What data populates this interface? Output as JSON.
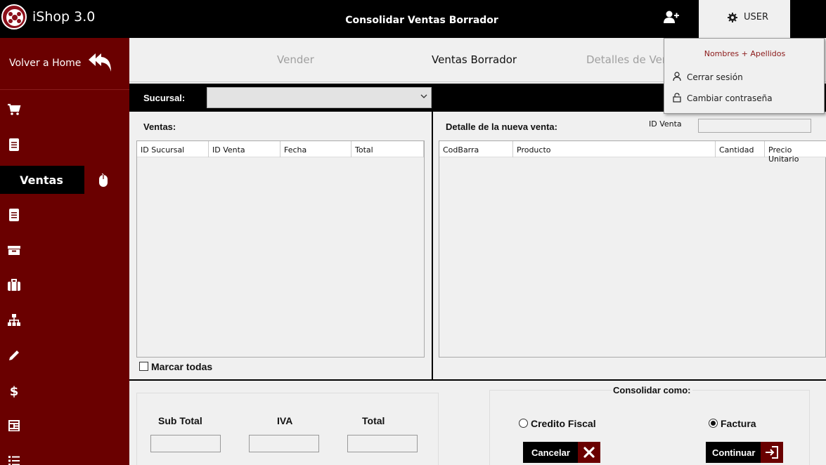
{
  "app": {
    "name": "iShop 3.0",
    "page_title": "Consolidar Ventas Borrador"
  },
  "header": {
    "user_label": "USER"
  },
  "user_menu": {
    "name": "Nombres + Apellidos",
    "items": [
      {
        "label": "Cerrar sesión",
        "icon": "person-icon"
      },
      {
        "label": "Cambiar contraseña",
        "icon": "lock-icon"
      }
    ]
  },
  "sidebar": {
    "home_label": "Volver a Home",
    "active_label": "Ventas",
    "icons": [
      "cart-icon",
      "document-icon",
      "document-icon",
      "inbox-icon",
      "briefcase-icon",
      "sitemap-icon",
      "pencil-icon",
      "dollar-icon",
      "newspaper-icon",
      "list-icon"
    ]
  },
  "tabs": [
    {
      "label": "Vender",
      "active": false
    },
    {
      "label": "Ventas Borrador",
      "active": true
    },
    {
      "label": "Detalles de Venta",
      "active": false
    }
  ],
  "filters": {
    "sucursal_label": "Sucursal:",
    "sucursal_value": ""
  },
  "ventas": {
    "title": "Ventas:",
    "columns": [
      "ID Sucursal",
      "ID Venta",
      "Fecha",
      "Total"
    ],
    "rows": [],
    "select_all_label": "Marcar todas"
  },
  "detalle": {
    "title": "Detalle de la nueva venta:",
    "id_venta_label": "ID Venta",
    "id_venta_value": "",
    "columns": [
      "CodBarra",
      "Producto",
      "Cantidad",
      "Precio Unitario"
    ],
    "rows": []
  },
  "totals": {
    "subtotal_label": "Sub Total",
    "iva_label": "IVA",
    "total_label": "Total"
  },
  "consolidar": {
    "title": "Consolidar como:",
    "options": [
      "Credito Fiscal",
      "Factura"
    ],
    "selected": "Factura",
    "cancel_label": "Cancelar",
    "continue_label": "Continuar"
  },
  "colors": {
    "sidebar": "#6a0000",
    "topbar": "#000000",
    "accent_text": "#8b1a1a"
  }
}
